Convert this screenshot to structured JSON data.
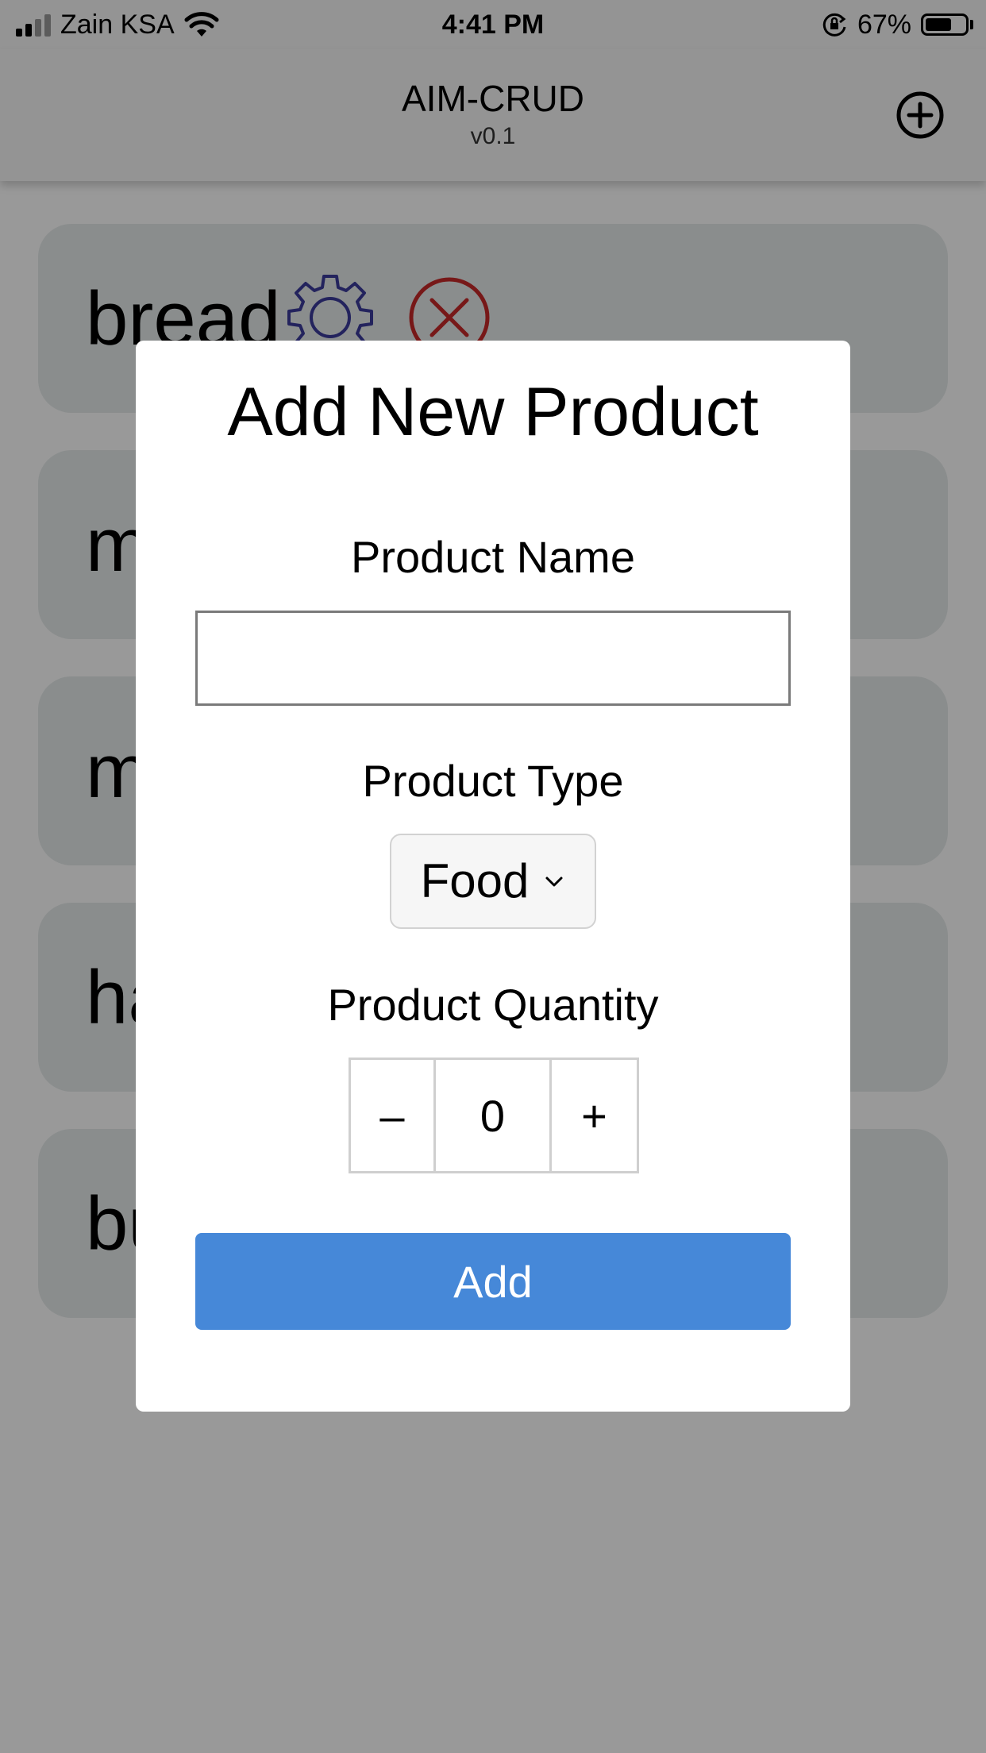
{
  "status_bar": {
    "carrier": "Zain KSA",
    "time": "4:41 PM",
    "battery_percent": "67%",
    "battery_level": 0.67,
    "signal_strength": 2,
    "icons": [
      "signal-icon",
      "wifi-icon",
      "orientation-lock-icon",
      "battery-icon"
    ]
  },
  "header": {
    "title": "AIM-CRUD",
    "version": "v0.1",
    "add_icon": "plus-circle-icon"
  },
  "product_list": {
    "items": [
      {
        "name": "bread",
        "edit_icon": "gear-icon",
        "delete_icon": "close-circle-icon"
      },
      {
        "name": "m"
      },
      {
        "name": "m"
      },
      {
        "name": "ha"
      },
      {
        "name": "bu"
      }
    ]
  },
  "modal": {
    "title": "Add New Product",
    "name_label": "Product Name",
    "name_value": "",
    "type_label": "Product Type",
    "type_selected": "Food",
    "quantity_label": "Product Quantity",
    "quantity_decrement": "–",
    "quantity_value": "0",
    "quantity_increment": "+",
    "submit_label": "Add"
  },
  "colors": {
    "primary_button": "#4688d8",
    "edit_icon": "#3b3b9c",
    "delete_icon": "#c62828",
    "card_background": "#e6ebeb",
    "header_background": "#f7f7f7"
  }
}
